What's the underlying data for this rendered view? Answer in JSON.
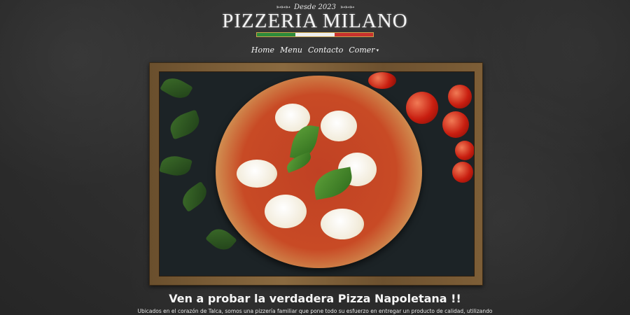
{
  "header": {
    "since_text": "Desde 2023",
    "brand_name": "PIZZERIA MILANO",
    "flag_colors": [
      "#2e8b3a",
      "#eeeeee",
      "#c8322d"
    ]
  },
  "nav": {
    "items": [
      {
        "label": "Home"
      },
      {
        "label": "Menu"
      },
      {
        "label": "Contacto"
      },
      {
        "label": "Comer",
        "has_dropdown": true
      }
    ]
  },
  "hero": {
    "image_subject": "pizza-margherita"
  },
  "content": {
    "headline": "Ven a probar la verdadera Pizza Napoletana !!",
    "intro": "Ubicados en el corazón de Talca, somos una pizzería familiar que pone todo su esfuerzo en entregar un producto de calidad, utilizando"
  },
  "theme": {
    "background": "#2f2f2f",
    "frame_wood": "#7d5e37",
    "text": "#f2f2f2"
  }
}
